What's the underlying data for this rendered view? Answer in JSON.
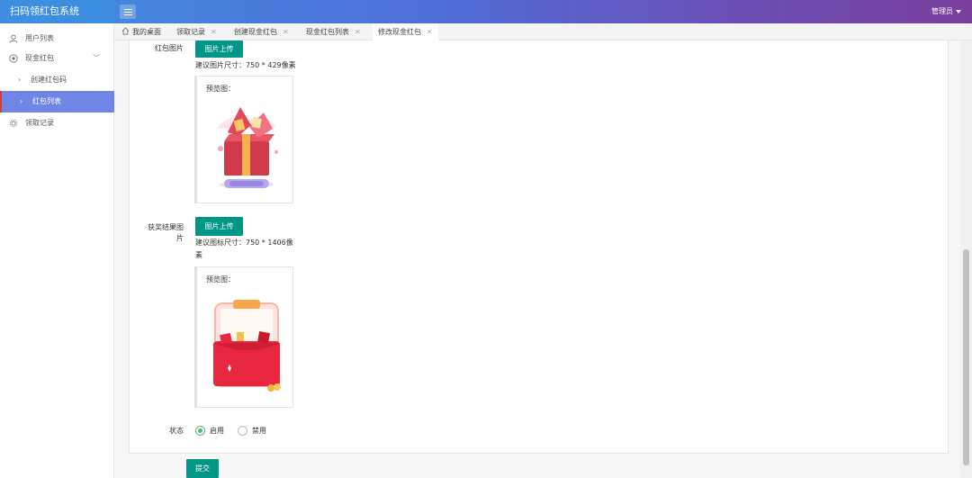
{
  "header": {
    "brand": "扫码领红包系统",
    "admin_label": "管理员"
  },
  "sidebar": {
    "items": [
      {
        "label": "用户列表",
        "icon": "user-icon"
      },
      {
        "label": "现金红包",
        "icon": "money-icon",
        "expanded": true
      },
      {
        "label": "创建红包码",
        "sub": true
      },
      {
        "label": "红包列表",
        "sub": true,
        "active": true
      },
      {
        "label": "领取记录",
        "icon": "gear-icon"
      }
    ]
  },
  "tabs": [
    {
      "label": "我的桌面",
      "closable": false
    },
    {
      "label": "领取记录",
      "closable": true
    },
    {
      "label": "创建现金红包",
      "closable": true
    },
    {
      "label": "现金红包列表",
      "closable": true
    },
    {
      "label": "修改现金红包",
      "closable": true,
      "active": true
    }
  ],
  "form": {
    "redpack_image": {
      "label": "红包图片",
      "upload_button": "图片上传",
      "hint": "建议图片尺寸：750 * 429像素",
      "preview_label": "预览图："
    },
    "result_image": {
      "label_line1": "获奖结果图",
      "label_line2": "片",
      "upload_button": "图片上传",
      "hint_line1": "建议图标尺寸：750 * 1406像",
      "hint_line2": "素",
      "preview_label": "预览图："
    },
    "status": {
      "label": "状态",
      "options": [
        {
          "label": "启用",
          "selected": true
        },
        {
          "label": "禁用",
          "selected": false
        }
      ]
    },
    "submit_button": "提交"
  },
  "colors": {
    "brand_blue": "#3d8ee0",
    "header_purple": "#7a3f9e",
    "active_nav": "#6f86e6",
    "button_green": "#009688",
    "radio_green": "#5fb878"
  }
}
